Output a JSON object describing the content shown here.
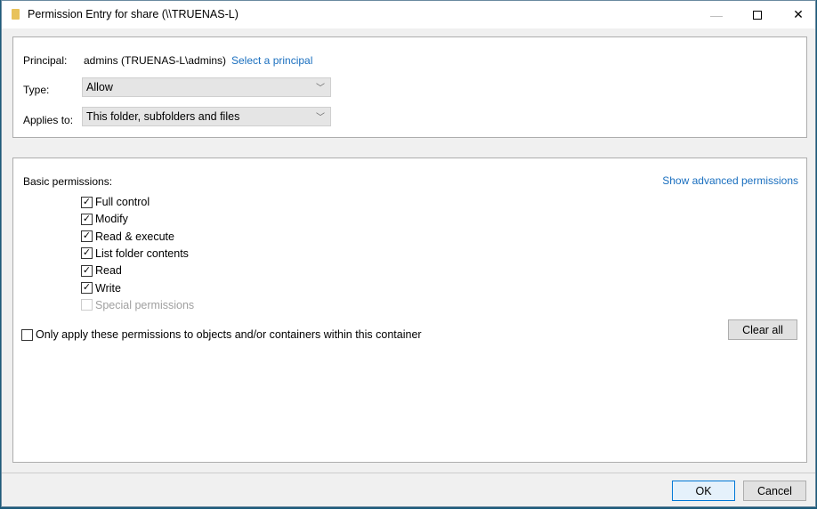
{
  "window": {
    "title": "Permission Entry for share (\\\\TRUENAS-L)",
    "icon": "folder-icon"
  },
  "principal": {
    "label": "Principal:",
    "value": "admins (TRUENAS-L\\admins)",
    "link": "Select a principal"
  },
  "type": {
    "label": "Type:",
    "value": "Allow"
  },
  "applies_to": {
    "label": "Applies to:",
    "value": "This folder, subfolders and files"
  },
  "permissions": {
    "label": "Basic permissions:",
    "advanced_link": "Show advanced permissions",
    "items": [
      {
        "label": "Full control",
        "checked": true,
        "enabled": true
      },
      {
        "label": "Modify",
        "checked": true,
        "enabled": true
      },
      {
        "label": "Read & execute",
        "checked": true,
        "enabled": true
      },
      {
        "label": "List folder contents",
        "checked": true,
        "enabled": true
      },
      {
        "label": "Read",
        "checked": true,
        "enabled": true
      },
      {
        "label": "Write",
        "checked": true,
        "enabled": true
      },
      {
        "label": "Special permissions",
        "checked": false,
        "enabled": false
      }
    ],
    "only_apply": {
      "label": "Only apply these permissions to objects and/or containers within this container",
      "checked": false
    },
    "clear_all": "Clear all"
  },
  "footer": {
    "ok": "OK",
    "cancel": "Cancel"
  }
}
